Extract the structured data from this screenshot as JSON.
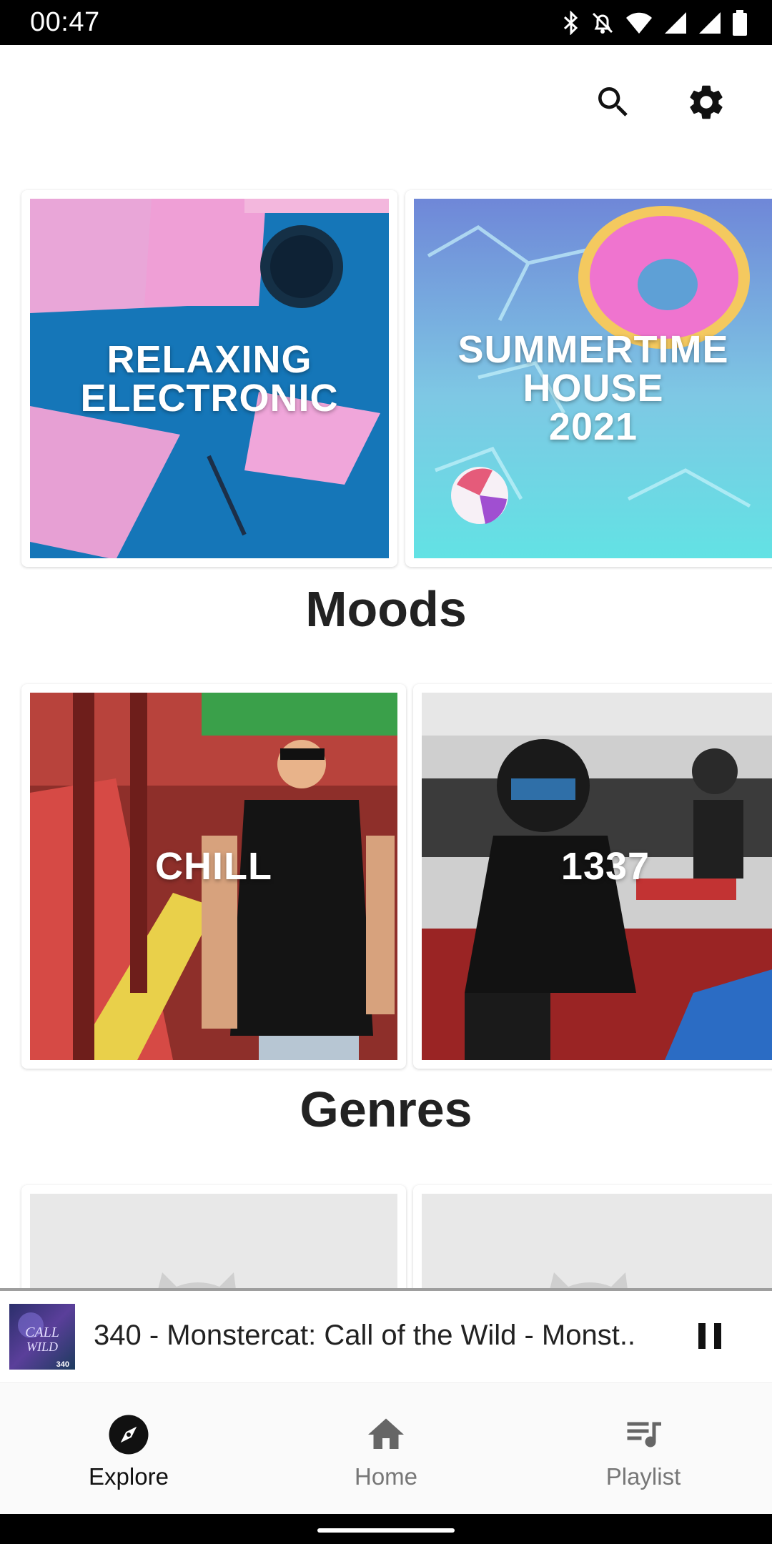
{
  "status_bar": {
    "time": "00:47",
    "icons": [
      "bluetooth-icon",
      "bell-off-icon",
      "wifi-icon",
      "signal-icon",
      "signal-icon",
      "battery-icon"
    ]
  },
  "toolbar": {
    "icons": [
      "search-icon",
      "settings-icon"
    ]
  },
  "featured": [
    {
      "title_line1": "RELAXING",
      "title_line2": "ELECTRONIC"
    },
    {
      "title_line1": "SUMMERTIME",
      "title_line2": "HOUSE",
      "title_line3": "2021"
    }
  ],
  "sections": {
    "moods": "Moods",
    "genres": "Genres"
  },
  "moods": [
    {
      "title": "CHILL"
    },
    {
      "title": "1337"
    }
  ],
  "player": {
    "title": "340 - Monstercat: Call of the Wild - Monst..",
    "art_text_1": "CALL",
    "art_text_2": "WILD",
    "art_number": "340",
    "state_icon": "pause-icon"
  },
  "bottom_nav": {
    "items": [
      {
        "label": "Explore",
        "icon": "compass-icon",
        "active": true
      },
      {
        "label": "Home",
        "icon": "home-icon",
        "active": false
      },
      {
        "label": "Playlist",
        "icon": "playlist-icon",
        "active": false
      }
    ]
  },
  "colors": {
    "active_nav": "#111111",
    "inactive_nav": "#777777",
    "accent": "#000000"
  }
}
